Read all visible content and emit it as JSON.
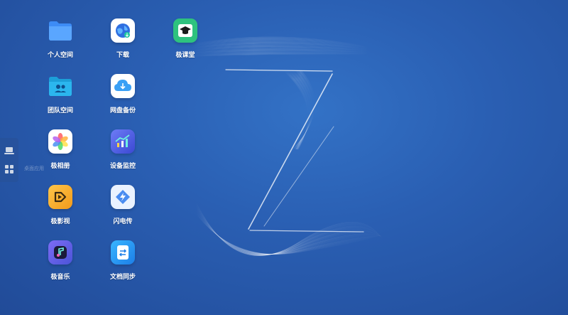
{
  "desktop": {
    "icons": [
      {
        "label": "个人空间",
        "icon": "folder-icon"
      },
      {
        "label": "团队空间",
        "icon": "team-folder-icon"
      },
      {
        "label": "极相册",
        "icon": "photos-icon"
      },
      {
        "label": "极影视",
        "icon": "video-icon"
      },
      {
        "label": "极音乐",
        "icon": "music-icon"
      },
      {
        "label": "下载",
        "icon": "download-globe-icon"
      },
      {
        "label": "网盘备份",
        "icon": "cloud-backup-icon"
      },
      {
        "label": "设备监控",
        "icon": "monitor-chart-icon"
      },
      {
        "label": "闪电传",
        "icon": "lightning-transfer-icon"
      },
      {
        "label": "文档同步",
        "icon": "doc-sync-icon"
      },
      {
        "label": "极课堂",
        "icon": "graduation-cap-icon"
      }
    ]
  },
  "dock": {
    "items": [
      {
        "name": "show-desktop",
        "icon": "laptop-icon"
      },
      {
        "name": "apps",
        "icon": "grid-apps-icon"
      }
    ],
    "tooltip": "桌面应用"
  },
  "colors": {
    "background": "#2a5fb3",
    "accent": "#4a8cf0"
  }
}
